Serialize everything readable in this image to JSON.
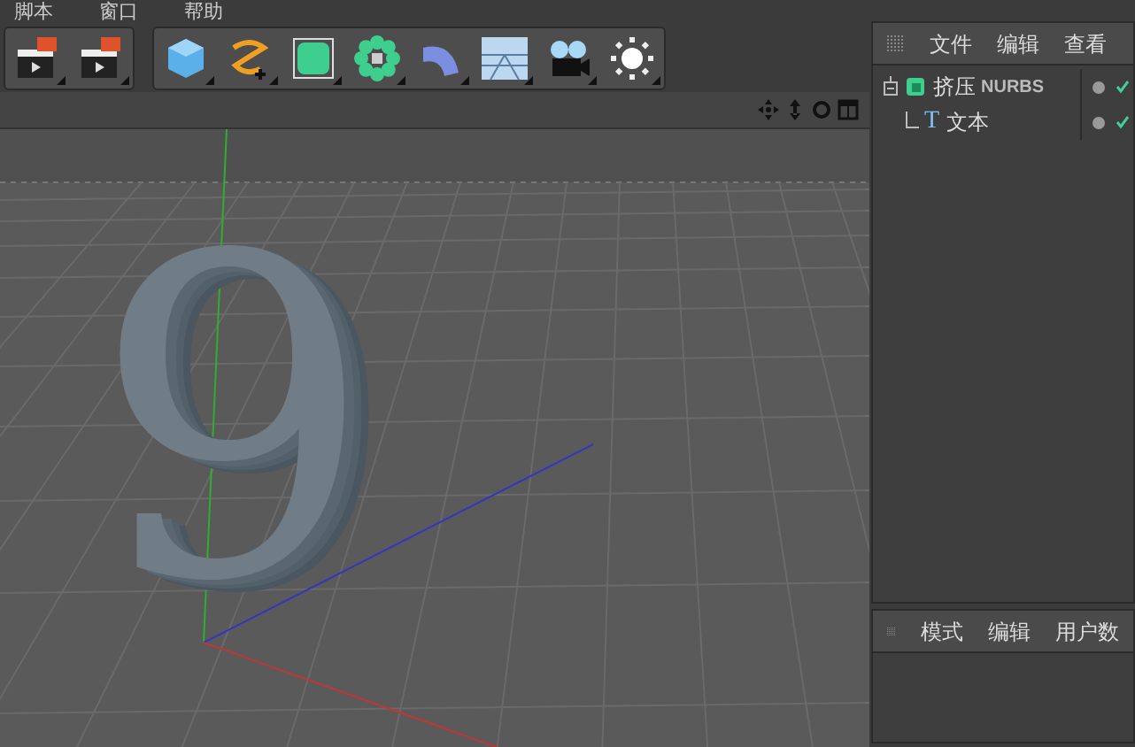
{
  "menu": [
    "脚本",
    "窗口",
    "帮助"
  ],
  "viewport": {
    "model_text": "9"
  },
  "object_manager": {
    "menu": [
      "文件",
      "编辑",
      "查看"
    ],
    "objects": [
      {
        "name": "挤压",
        "tag": "NURBS",
        "expanded": true,
        "children": [
          {
            "name": "文本",
            "icon": "T"
          }
        ]
      }
    ]
  },
  "attribute_manager": {
    "menu": [
      "模式",
      "编辑",
      "用户数"
    ]
  }
}
